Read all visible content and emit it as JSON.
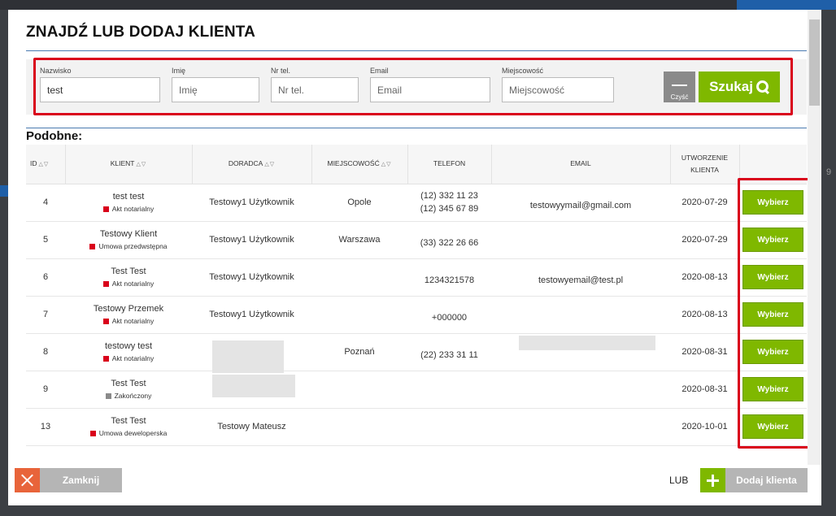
{
  "title": "ZNAJDŹ LUB DODAJ KLIENTA",
  "search": {
    "fields": [
      {
        "label": "Nazwisko",
        "value": "test",
        "placeholder": "Nazwisko"
      },
      {
        "label": "Imię",
        "value": "",
        "placeholder": "Imię"
      },
      {
        "label": "Nr tel.",
        "value": "",
        "placeholder": "Nr tel."
      },
      {
        "label": "Email",
        "value": "",
        "placeholder": "Email"
      },
      {
        "label": "Miejscowość",
        "value": "",
        "placeholder": "Miejscowość"
      }
    ],
    "clear_label": "Czyść",
    "search_label": "Szukaj"
  },
  "similar_label": "Podobne:",
  "table": {
    "headers": {
      "id": "ID",
      "client": "KLIENT",
      "advisor": "DORADCA",
      "city": "MIEJSCOWOŚĆ",
      "phone": "TELEFON",
      "email": "EMAIL",
      "created": "UTWORZENIE KLIENTA"
    },
    "select_label": "Wybierz",
    "rows": [
      {
        "id": "4",
        "name": "test test",
        "status": "Akt notarialny",
        "status_color": "#d9001b",
        "advisor": "Testowy1 Użytkownik",
        "city": "Opole",
        "phone1": "(12) 332 11 23",
        "phone2": "(12) 345 67 89",
        "email": "testowyymail@gmail.com",
        "created": "2020-07-29"
      },
      {
        "id": "5",
        "name": "Testowy Klient",
        "status": "Umowa przedwstępna",
        "status_color": "#d9001b",
        "advisor": "Testowy1 Użytkownik",
        "city": "Warszawa",
        "phone1": "(33) 322 26 66",
        "phone2": "",
        "email": "",
        "created": "2020-07-29"
      },
      {
        "id": "6",
        "name": "Test Test",
        "status": "Akt notarialny",
        "status_color": "#d9001b",
        "advisor": "Testowy1 Użytkownik",
        "city": "",
        "phone1": "1234321578",
        "phone2": "",
        "email": "testowyemail@test.pl",
        "created": "2020-08-13"
      },
      {
        "id": "7",
        "name": "Testowy Przemek",
        "status": "Akt notarialny",
        "status_color": "#d9001b",
        "advisor": "Testowy1 Użytkownik",
        "city": "",
        "phone1": "+000000",
        "phone2": "",
        "email": "",
        "created": "2020-08-13"
      },
      {
        "id": "8",
        "name": "testowy test",
        "status": "Akt notarialny",
        "status_color": "#d9001b",
        "advisor": "",
        "city": "Poznań",
        "phone1": "(22) 233 31 11",
        "phone2": "",
        "email": "",
        "created": "2020-08-31"
      },
      {
        "id": "9",
        "name": "Test Test",
        "status": "Zakończony",
        "status_color": "#8a8a8a",
        "advisor": "",
        "city": "",
        "phone1": "",
        "phone2": "",
        "email": "",
        "created": "2020-08-31"
      },
      {
        "id": "13",
        "name": "Test Test",
        "status": "Umowa deweloperska",
        "status_color": "#d9001b",
        "advisor": "Testowy Mateusz",
        "city": "",
        "phone1": "",
        "phone2": "",
        "email": "",
        "created": "2020-10-01"
      }
    ]
  },
  "footer": {
    "close_label": "Zamknij",
    "or_label": "LUB",
    "add_label": "Dodaj klienta"
  },
  "colors": {
    "accent_green": "#7fb800",
    "highlight_red": "#d9001b",
    "close_orange": "#e8643a",
    "rule_blue": "#4a7ab0"
  }
}
